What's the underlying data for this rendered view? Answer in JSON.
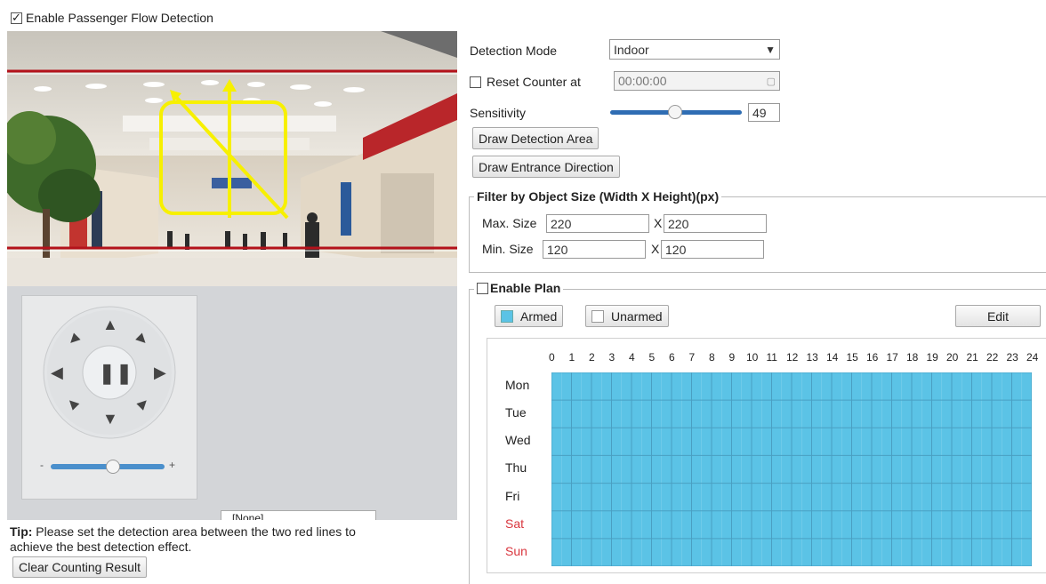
{
  "enable_detection": {
    "label": "Enable Passenger Flow Detection",
    "checked": true
  },
  "video": {
    "has_detection_lines": true
  },
  "ptz": {
    "zoom_minus": "-",
    "zoom_plus": "+",
    "zoom_level": 0.55,
    "preset_select": "[None]"
  },
  "tip": {
    "prefix": "Tip:",
    "line1": " Please set the detection area between the two red lines to",
    "line2": "achieve the best detection effect."
  },
  "clear_button": "Clear Counting Result",
  "settings": {
    "detection_mode_label": "Detection Mode",
    "detection_mode_value": "Indoor",
    "reset_counter_label": "Reset Counter at",
    "reset_counter_checked": false,
    "reset_counter_time": "00:00:00",
    "sensitivity_label": "Sensitivity",
    "sensitivity_value": "49",
    "sensitivity_fraction": 0.49,
    "draw_area_button": "Draw Detection Area",
    "draw_direction_button": "Draw Entrance Direction"
  },
  "filter": {
    "legend": "Filter by Object Size (Width X Height)(px)",
    "max_label": "Max. Size",
    "max_width": "220",
    "max_height": "220",
    "min_label": "Min. Size",
    "min_width": "120",
    "min_height": "120",
    "x_sep": "X"
  },
  "plan": {
    "legend": "Enable Plan",
    "checked": false,
    "armed_label": "Armed",
    "unarmed_label": "Unarmed",
    "edit_label": "Edit",
    "hours": [
      "0",
      "1",
      "2",
      "3",
      "4",
      "5",
      "6",
      "7",
      "8",
      "9",
      "10",
      "11",
      "12",
      "13",
      "14",
      "15",
      "16",
      "17",
      "18",
      "19",
      "20",
      "21",
      "22",
      "23",
      "24"
    ],
    "days": [
      {
        "label": "Mon",
        "weekend": false
      },
      {
        "label": "Tue",
        "weekend": false
      },
      {
        "label": "Wed",
        "weekend": false
      },
      {
        "label": "Thu",
        "weekend": false
      },
      {
        "label": "Fri",
        "weekend": false
      },
      {
        "label": "Sat",
        "weekend": true
      },
      {
        "label": "Sun",
        "weekend": true
      }
    ],
    "armed_color": "#5bc3e6",
    "weekend_color": "#d9363e"
  }
}
